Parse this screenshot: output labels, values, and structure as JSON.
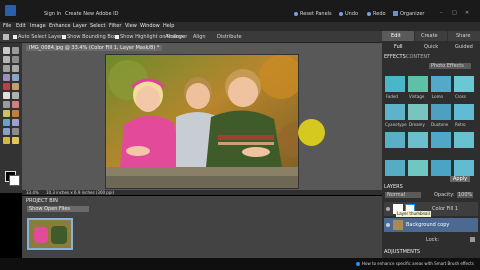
{
  "titlebar": {
    "user": "Sign In",
    "account": "Create New Adobe ID",
    "actions": [
      "Reset Panels",
      "Undo",
      "Redo",
      "Organizer"
    ]
  },
  "menu": [
    "File",
    "Edit",
    "Image",
    "Enhance",
    "Layer",
    "Select",
    "Filter",
    "View",
    "Window",
    "Help"
  ],
  "options": {
    "auto_select": "Auto Select Layer",
    "bounding_box": "Show Bounding Box",
    "highlight": "Show Highlight on Rollover",
    "arrange": "Arrange",
    "align": "Align",
    "distribute": "Distribute"
  },
  "document": {
    "tab": "IMG_0084.jpg @ 33.4% (Color Fill 1, Layer Mask/8) *",
    "zoom": "33.4%",
    "size": "10.3 inches x 6.9 inches (300 ppi)"
  },
  "project_bin": {
    "title": "PROJECT BIN",
    "source": "Show Open Files"
  },
  "panel": {
    "tabs": [
      "Edit",
      "Create",
      "Share"
    ],
    "subtabs": [
      "Full",
      "Quick",
      "Guided"
    ],
    "effects_title": "EFFECTS",
    "effects_label": "CONTENT",
    "effects_category": "Photo Effects",
    "effect_labels": [
      "Faded",
      "Vintage",
      "Lomo",
      "Cross",
      "Cyanotype",
      "Dreamy",
      "Duotone",
      "Retro"
    ],
    "apply": "Apply",
    "layers_title": "LAYERS",
    "blend": "Normal",
    "opacity_label": "Opacity:",
    "opacity": "100%",
    "lock": "Lock:",
    "layers": [
      "Color Fill 1",
      "Background copy"
    ],
    "tooltip": "Layer thumbnail",
    "adjustments": "ADJUSTMENTS"
  },
  "status": "How to enhance specific areas with Smart Brush effects",
  "colors": {
    "accent": "#2a8fd8",
    "highlight": "#e3d51a"
  }
}
